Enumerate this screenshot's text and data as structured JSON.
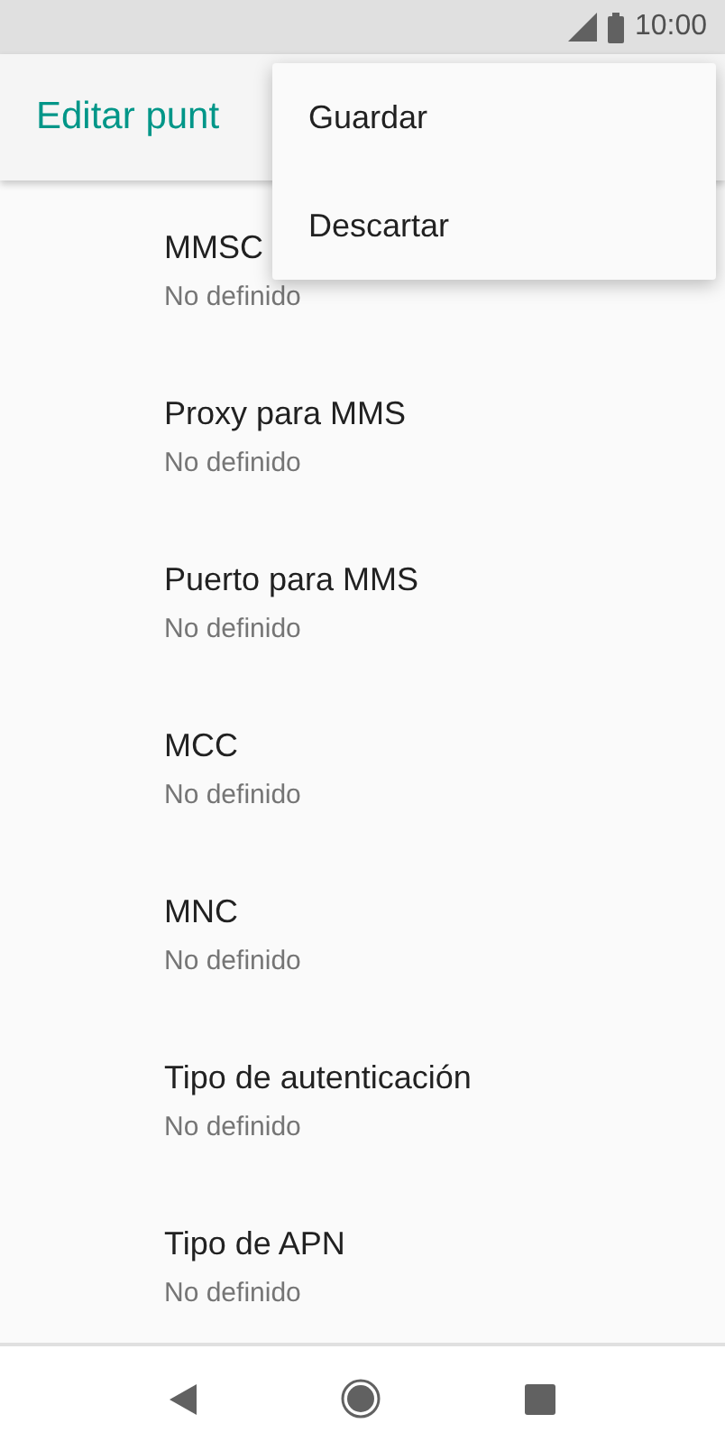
{
  "status_bar": {
    "time": "10:00"
  },
  "app_bar": {
    "title": "Editar punt"
  },
  "menu": [
    {
      "label": "Guardar"
    },
    {
      "label": "Descartar"
    }
  ],
  "settings": [
    {
      "title": "MMSC",
      "value": "No definido"
    },
    {
      "title": "Proxy para MMS",
      "value": "No definido"
    },
    {
      "title": "Puerto para MMS",
      "value": "No definido"
    },
    {
      "title": "MCC",
      "value": "No definido"
    },
    {
      "title": "MNC",
      "value": "No definido"
    },
    {
      "title": "Tipo de autenticación",
      "value": "No definido"
    },
    {
      "title": "Tipo de APN",
      "value": "No definido"
    }
  ]
}
